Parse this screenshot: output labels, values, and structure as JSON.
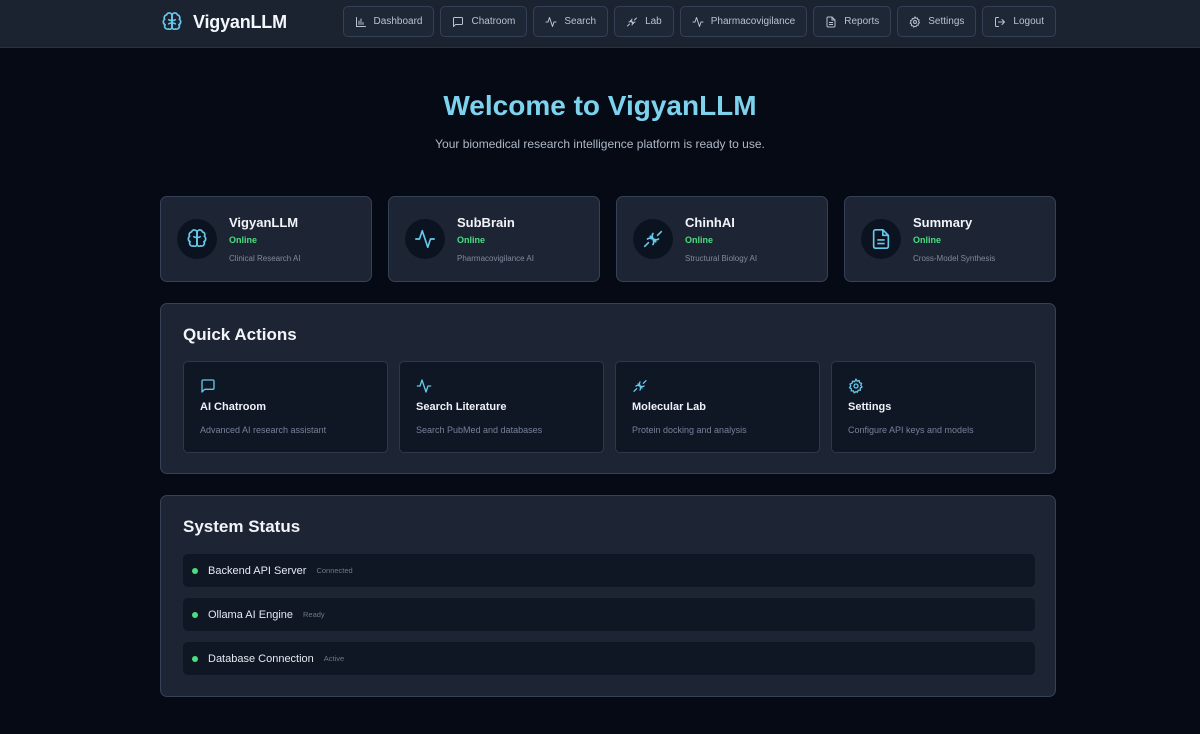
{
  "brand": {
    "name": "VigyanLLM",
    "icon": "brain-icon",
    "accent": "#7dd3ee"
  },
  "nav": [
    {
      "label": "Dashboard",
      "icon": "bar-chart-icon"
    },
    {
      "label": "Chatroom",
      "icon": "chat-icon"
    },
    {
      "label": "Search",
      "icon": "activity-icon"
    },
    {
      "label": "Lab",
      "icon": "dna-icon"
    },
    {
      "label": "Pharmacovigilance",
      "icon": "activity-icon"
    },
    {
      "label": "Reports",
      "icon": "document-icon"
    },
    {
      "label": "Settings",
      "icon": "gear-icon"
    },
    {
      "label": "Logout",
      "icon": "logout-icon"
    }
  ],
  "hero": {
    "title": "Welcome to VigyanLLM",
    "subtitle": "Your biomedical research intelligence platform is ready to use."
  },
  "models": [
    {
      "name": "VigyanLLM",
      "status": "Online",
      "desc": "Clinical Research AI",
      "icon": "brain-icon"
    },
    {
      "name": "SubBrain",
      "status": "Online",
      "desc": "Pharmacovigilance AI",
      "icon": "activity-icon"
    },
    {
      "name": "ChinhAI",
      "status": "Online",
      "desc": "Structural Biology AI",
      "icon": "dna-icon"
    },
    {
      "name": "Summary",
      "status": "Online",
      "desc": "Cross-Model Synthesis",
      "icon": "document-icon"
    }
  ],
  "quick_actions": {
    "title": "Quick Actions",
    "items": [
      {
        "name": "AI Chatroom",
        "desc": "Advanced AI research assistant",
        "icon": "chat-icon"
      },
      {
        "name": "Search Literature",
        "desc": "Search PubMed and databases",
        "icon": "activity-icon"
      },
      {
        "name": "Molecular Lab",
        "desc": "Protein docking and analysis",
        "icon": "dna-icon"
      },
      {
        "name": "Settings",
        "desc": "Configure API keys and models",
        "icon": "gear-icon"
      }
    ]
  },
  "system_status": {
    "title": "System Status",
    "items": [
      {
        "name": "Backend API Server",
        "state": "Connected"
      },
      {
        "name": "Ollama AI Engine",
        "state": "Ready"
      },
      {
        "name": "Database Connection",
        "state": "Active"
      }
    ],
    "ok_color": "#4ade80"
  }
}
